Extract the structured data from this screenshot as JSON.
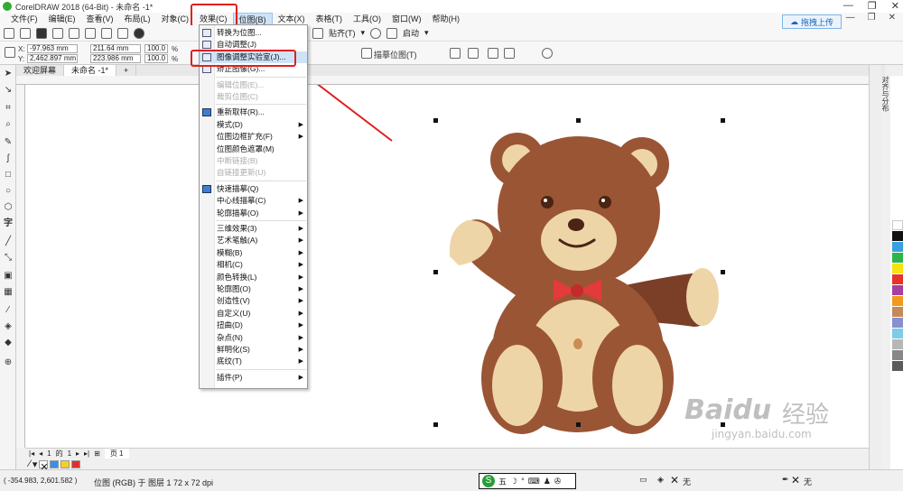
{
  "window": {
    "title": "CorelDRAW 2018 (64-Bit) - 未命名 -1*",
    "minimize": "—",
    "restore": "❐",
    "close": "✕"
  },
  "menubar": {
    "items": [
      "文件(F)",
      "编辑(E)",
      "查看(V)",
      "布局(L)",
      "对象(C)",
      "效果(C)",
      "位图(B)",
      "文本(X)",
      "表格(T)",
      "工具(O)",
      "窗口(W)",
      "帮助(H)"
    ],
    "active_index": 6
  },
  "toolbar": {
    "upload_label": "拖拽上传",
    "snap_label": "贴齐(T)",
    "launch_label": "启动"
  },
  "propbar": {
    "x_label": "X:",
    "x_value": "-97.963 mm",
    "y_label": "Y:",
    "y_value": "2,462.897 mm",
    "w_value": "211.64 mm",
    "h_value": "223.986 mm",
    "scale_x": "100.0",
    "scale_y": "100.0",
    "pct": "%",
    "trace_label": "描摹位图(T)"
  },
  "tabs": {
    "welcome": "欢迎屏幕",
    "document": "未命名 -1*",
    "add": "+"
  },
  "bitmap_menu": {
    "items": [
      {
        "label": "转换为位图...",
        "state": "normal",
        "icon": "convert-bitmap-icon"
      },
      {
        "label": "自动调整(J)",
        "state": "normal",
        "icon": "auto-adjust-icon"
      },
      {
        "label": "图像调整实验室(J)...",
        "state": "highlighted",
        "icon": "image-adjust-lab-icon"
      },
      {
        "label": "矫正图像(G)...",
        "state": "normal",
        "icon": "straighten-icon"
      },
      {
        "label": "编辑位图(E)...",
        "state": "disabled",
        "icon": ""
      },
      {
        "label": "裁剪位图(C)",
        "state": "disabled",
        "icon": ""
      },
      {
        "label": "重新取样(R)...",
        "state": "normal",
        "icon": "resample-icon"
      },
      {
        "label": "模式(D)",
        "state": "submenu",
        "icon": ""
      },
      {
        "label": "位图边框扩充(F)",
        "state": "submenu",
        "icon": ""
      },
      {
        "label": "位图颜色遮罩(M)",
        "state": "normal",
        "icon": ""
      },
      {
        "label": "中断链接(B)",
        "state": "disabled",
        "icon": ""
      },
      {
        "label": "自链接更新(U)",
        "state": "disabled",
        "icon": ""
      },
      {
        "label": "快速描摹(Q)",
        "state": "normal",
        "icon": "quick-trace-icon"
      },
      {
        "label": "中心线描摹(C)",
        "state": "submenu",
        "icon": ""
      },
      {
        "label": "轮廓描摹(O)",
        "state": "submenu",
        "icon": ""
      },
      {
        "label": "三维效果(3)",
        "state": "submenu",
        "icon": ""
      },
      {
        "label": "艺术笔触(A)",
        "state": "submenu",
        "icon": ""
      },
      {
        "label": "模糊(B)",
        "state": "submenu",
        "icon": ""
      },
      {
        "label": "相机(C)",
        "state": "submenu",
        "icon": ""
      },
      {
        "label": "颜色转换(L)",
        "state": "submenu",
        "icon": ""
      },
      {
        "label": "轮廓图(O)",
        "state": "submenu",
        "icon": ""
      },
      {
        "label": "创造性(V)",
        "state": "submenu",
        "icon": ""
      },
      {
        "label": "自定义(U)",
        "state": "submenu",
        "icon": ""
      },
      {
        "label": "扭曲(D)",
        "state": "submenu",
        "icon": ""
      },
      {
        "label": "杂点(N)",
        "state": "submenu",
        "icon": ""
      },
      {
        "label": "鲜明化(S)",
        "state": "submenu",
        "icon": ""
      },
      {
        "label": "底纹(T)",
        "state": "submenu",
        "icon": ""
      },
      {
        "label": "插件(P)",
        "state": "submenu",
        "icon": ""
      }
    ]
  },
  "docker": {
    "title": "对齐与分布"
  },
  "pagenav": {
    "current": "1",
    "of": "的",
    "total": "1",
    "page_tab": "页 1"
  },
  "statusbar": {
    "coords": "( -354.983, 2,601.582 )",
    "object_info": "位图 (RGB) 于 图层 1 72 x 72 dpi",
    "ime_text": "五",
    "fill_none": "无",
    "outline_none": "无"
  },
  "watermark": {
    "brand": "Baidu",
    "cn": "经验",
    "url": "jingyan.baidu.com"
  },
  "colors": {
    "accent_red": "#e02020",
    "menu_highlight": "#cfe3f7",
    "bear_brown": "#9a5535",
    "bear_dark": "#7a3f26",
    "bear_tan": "#eed5a8",
    "bow_red": "#e33a3a"
  }
}
